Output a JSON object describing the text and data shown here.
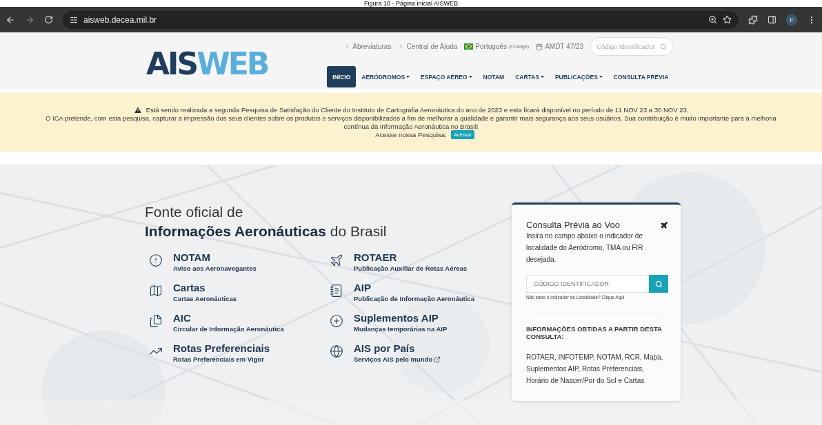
{
  "caption": "Figura 10 - Página inicial AISWEB",
  "browser": {
    "url": "aisweb.decea.mil.br",
    "profile": "F"
  },
  "header": {
    "logo": [
      {
        "text": "AIS",
        "color": "#1f3d5c"
      },
      {
        "text": "WEB",
        "color": "#5aaedc"
      }
    ],
    "top_links": [
      {
        "label": "Abreviaturas"
      },
      {
        "label": "Central de Ajuda"
      }
    ],
    "language": {
      "label": "Português",
      "action": "(Change)"
    },
    "amendment": "AMDT 47/23",
    "search": {
      "placeholder": "Código Identificador"
    },
    "nav": [
      {
        "label": "INÍCIO",
        "selected": true,
        "dropdown": false
      },
      {
        "label": "AERÓDROMOS",
        "selected": false,
        "dropdown": true
      },
      {
        "label": "ESPAÇO AÉREO",
        "selected": false,
        "dropdown": true
      },
      {
        "label": "NOTAM",
        "selected": false,
        "dropdown": false
      },
      {
        "label": "CARTAS",
        "selected": false,
        "dropdown": true
      },
      {
        "label": "PUBLICAÇÕES",
        "selected": false,
        "dropdown": true
      },
      {
        "label": "CONSULTA PRÉVIA",
        "selected": false,
        "dropdown": false
      }
    ]
  },
  "notice": {
    "first": "Está sendo realizada a segunda Pesquisa de Satisfação do Cliente do Instituto de Cartografia Aeronáutica do ano de 2023 e esta ficará disponível no período de 11 NOV 23 a 30 NOV 23.",
    "second": "O ICA pretende, com esta pesquisa, capturar a impressão dos seus clientes sobre os produtos e serviços disponibilizados a fim de melhorar a qualidade e garantir mais segurança aos seus usuários. Sua contribuição é muito importante para a melhoria contínua da Informação Aeronáutica no Brasil!",
    "prompt": "Acesse nossa Pesquisa:",
    "button": "Acessar"
  },
  "hero": {
    "title_light": "Fonte oficial de",
    "title": "**Informações Aeronáuticas** do Brasil",
    "services": [
      {
        "title": "NOTAM",
        "subtitle": "Aviso aos Aeronavegantes",
        "external": false
      },
      {
        "title": "ROTAER",
        "subtitle": "Publicação Auxiliar de Rotas Aéreas",
        "external": false
      },
      {
        "title": "Cartas",
        "subtitle": "Cartas Aeronáuticas",
        "external": false
      },
      {
        "title": "AIP",
        "subtitle": "Publicação de Informação Aeronáutica",
        "external": false
      },
      {
        "title": "AIC",
        "subtitle": "Circular de Informação Aeronáutica",
        "external": false
      },
      {
        "title": "Suplementos AIP",
        "subtitle": "Mudanças temporárias na AIP",
        "external": false
      },
      {
        "title": "Rotas Preferenciais",
        "subtitle": "Rotas Preferenciais em Vigor",
        "external": false
      },
      {
        "title": "AIS por País",
        "subtitle": "Serviços AIS pelo mundo",
        "external": true
      }
    ]
  },
  "consulta": {
    "title": "Consulta Prévia ao Voo",
    "description": "Insira no campo abaixo o indicador de localidade do Aeródromo, TMA ou FIR desejada.",
    "placeholder": "CÓDIGO IDENTIFICADOR",
    "help": "Não sabe o Indicador de Localidade? Clique Aqui",
    "info_heading": "INFORMAÇÕES OBTIDAS A PARTIR DESTA CONSULTA:",
    "info": "ROTAER, INFOTEMP, NOTAM, RCR, Mapa, Suplementos AIP, Rotas Preferenciais, Horário de Nascer/Por do Sol e Cartas"
  }
}
